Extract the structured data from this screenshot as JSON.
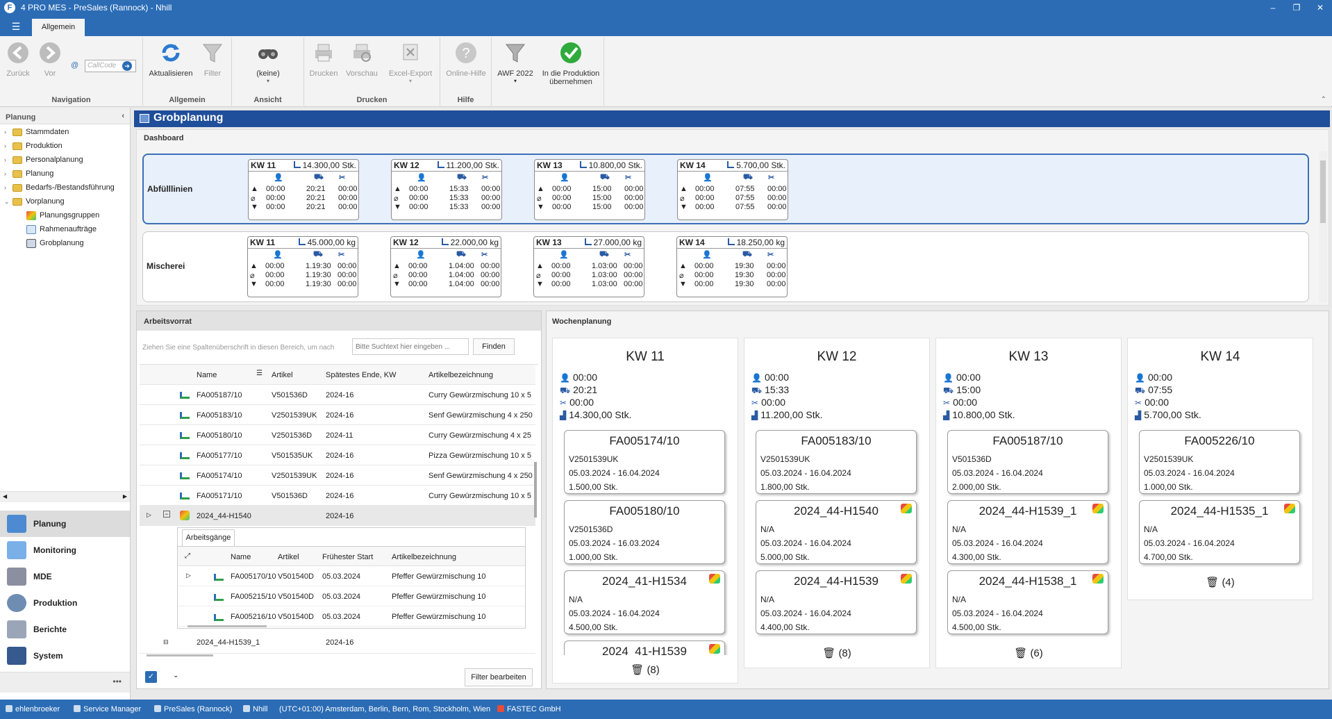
{
  "window": {
    "title": "4 PRO MES - PreSales (Rannock) - Nhill",
    "icon_letter": "F",
    "minimize": "–",
    "maximize": "❐",
    "close": "✕"
  },
  "ribbon": {
    "tab": "Allgemein",
    "navigation": {
      "label": "Navigation",
      "back": "Zurück",
      "forward": "Vor",
      "callcode_placeholder": "CallCode"
    },
    "allgemein": {
      "label": "Allgemein",
      "refresh": "Aktualisieren",
      "filter": "Filter"
    },
    "ansicht": {
      "label": "Ansicht",
      "view": "(keine)"
    },
    "drucken": {
      "label": "Drucken",
      "print": "Drucken",
      "preview": "Vorschau",
      "excel": "Excel-Export"
    },
    "hilfe": {
      "label": "Hilfe",
      "online": "Online-Hilfe"
    },
    "extra": {
      "awf": "AWF 2022",
      "prod_line1": "In die Produktion",
      "prod_line2": "übernehmen"
    }
  },
  "leftnav": {
    "title": "Planung",
    "tree": [
      "Stammdaten",
      "Produktion",
      "Personalplanung",
      "Planung",
      "Bedarfs-/Bestandsführung",
      "Vorplanung"
    ],
    "subtree": [
      "Planungsgruppen",
      "Rahmenaufträge",
      "Grobplanung"
    ],
    "modules": [
      "Planung",
      "Monitoring",
      "MDE",
      "Produktion",
      "Berichte",
      "System"
    ],
    "more": "•••"
  },
  "main": {
    "title": "Grobplanung"
  },
  "dashboard": {
    "title": "Dashboard",
    "rows": [
      {
        "label": "Abfülllinien",
        "weeks": [
          {
            "kw": "KW 11",
            "qty": "14.300,00 Stk.",
            "r": [
              [
                "00:00",
                "20:21",
                "00:00"
              ],
              [
                "00:00",
                "20:21",
                "00:00"
              ],
              [
                "00:00",
                "20:21",
                "00:00"
              ]
            ]
          },
          {
            "kw": "KW 12",
            "qty": "11.200,00 Stk.",
            "r": [
              [
                "00:00",
                "15:33",
                "00:00"
              ],
              [
                "00:00",
                "15:33",
                "00:00"
              ],
              [
                "00:00",
                "15:33",
                "00:00"
              ]
            ]
          },
          {
            "kw": "KW 13",
            "qty": "10.800,00 Stk.",
            "r": [
              [
                "00:00",
                "15:00",
                "00:00"
              ],
              [
                "00:00",
                "15:00",
                "00:00"
              ],
              [
                "00:00",
                "15:00",
                "00:00"
              ]
            ]
          },
          {
            "kw": "KW 14",
            "qty": "5.700,00 Stk.",
            "r": [
              [
                "00:00",
                "07:55",
                "00:00"
              ],
              [
                "00:00",
                "07:55",
                "00:00"
              ],
              [
                "00:00",
                "07:55",
                "00:00"
              ]
            ]
          }
        ]
      },
      {
        "label": "Mischerei",
        "weeks": [
          {
            "kw": "KW 11",
            "qty": "45.000,00 kg",
            "r": [
              [
                "00:00",
                "1.19:30",
                "00:00"
              ],
              [
                "00:00",
                "1.19:30",
                "00:00"
              ],
              [
                "00:00",
                "1.19:30",
                "00:00"
              ]
            ]
          },
          {
            "kw": "KW 12",
            "qty": "22.000,00 kg",
            "r": [
              [
                "00:00",
                "1.04:00",
                "00:00"
              ],
              [
                "00:00",
                "1.04:00",
                "00:00"
              ],
              [
                "00:00",
                "1.04:00",
                "00:00"
              ]
            ]
          },
          {
            "kw": "KW 13",
            "qty": "27.000,00 kg",
            "r": [
              [
                "00:00",
                "1.03:00",
                "00:00"
              ],
              [
                "00:00",
                "1.03:00",
                "00:00"
              ],
              [
                "00:00",
                "1.03:00",
                "00:00"
              ]
            ]
          },
          {
            "kw": "KW 14",
            "qty": "18.250,00 kg",
            "r": [
              [
                "00:00",
                "19:30",
                "00:00"
              ],
              [
                "00:00",
                "19:30",
                "00:00"
              ],
              [
                "00:00",
                "19:30",
                "00:00"
              ]
            ]
          }
        ]
      }
    ],
    "row_symbols": [
      "▲",
      "⌀",
      "▼"
    ]
  },
  "arbeitsvorrat": {
    "title": "Arbeitsvorrat",
    "group_hint": "Ziehen Sie eine Spaltenüberschrift in diesen Bereich, um nach",
    "search_placeholder": "Bitte Suchtext hier eingeben ...",
    "find": "Finden",
    "columns": [
      "Name",
      "Artikel",
      "Spätestes Ende, KW",
      "Artikelbezeichnung"
    ],
    "rows": [
      [
        "FA005187/10",
        "V501536D",
        "2024-16",
        "Curry Gewürzmischung 10 x 5"
      ],
      [
        "FA005183/10",
        "V2501539UK",
        "2024-16",
        "Senf Gewürzmischung 4 x 250"
      ],
      [
        "FA005180/10",
        "V2501536D",
        "2024-11",
        "Curry Gewürzmischung 4 x 25"
      ],
      [
        "FA005177/10",
        "V501535UK",
        "2024-16",
        "Pizza Gewürzmischung 10 x 5"
      ],
      [
        "FA005174/10",
        "V2501539UK",
        "2024-16",
        "Senf Gewürzmischung 4 x 250"
      ],
      [
        "FA005171/10",
        "V501536D",
        "2024-16",
        "Curry Gewürzmischung 10 x 5"
      ]
    ],
    "group_row": {
      "name": "2024_44-H1540",
      "kw": "2024-16"
    },
    "sub_tab": "Arbeitsgänge",
    "sub_columns": [
      "Name",
      "Artikel",
      "Frühester Start",
      "Artikelbezeichnung"
    ],
    "sub_rows": [
      [
        "FA005170/10",
        "V501540D",
        "05.03.2024",
        "Pfeffer Gewürzmischung 10"
      ],
      [
        "FA005215/10",
        "V501540D",
        "05.03.2024",
        "Pfeffer Gewürzmischung 10"
      ],
      [
        "FA005216/10",
        "V501540D",
        "05.03.2024",
        "Pfeffer Gewürzmischung 10"
      ]
    ],
    "partial_row": {
      "name": "2024_44-H1539_1",
      "kw": "2024-16"
    },
    "filter_edit": "Filter bearbeiten"
  },
  "wochenplanung": {
    "title": "Wochenplanung",
    "weeks": [
      {
        "kw": "KW 11",
        "s": [
          "00:00",
          "20:21",
          "00:00",
          "14.300,00 Stk."
        ],
        "trash": "(8)",
        "cards": [
          {
            "t": "FA005174/10",
            "a": "V2501539UK",
            "d": "05.03.2024 - 16.04.2024",
            "q": "1.500,00 Stk.",
            "g": false
          },
          {
            "t": "FA005180/10",
            "a": "V2501536D",
            "d": "05.03.2024 - 16.03.2024",
            "q": "1.000,00 Stk.",
            "g": false
          },
          {
            "t": "2024_41-H1534",
            "a": "N/A",
            "d": "05.03.2024 - 16.04.2024",
            "q": "4.500,00 Stk.",
            "g": true
          },
          {
            "t": "2024_41-H1539",
            "a": "",
            "d": "",
            "q": "",
            "g": true
          }
        ]
      },
      {
        "kw": "KW 12",
        "s": [
          "00:00",
          "15:33",
          "00:00",
          "11.200,00 Stk."
        ],
        "trash": "(8)",
        "cards": [
          {
            "t": "FA005183/10",
            "a": "V2501539UK",
            "d": "05.03.2024 - 16.04.2024",
            "q": "1.800,00 Stk.",
            "g": false
          },
          {
            "t": "2024_44-H1540",
            "a": "N/A",
            "d": "05.03.2024 - 16.04.2024",
            "q": "5.000,00 Stk.",
            "g": true
          },
          {
            "t": "2024_44-H1539",
            "a": "N/A",
            "d": "05.03.2024 - 16.04.2024",
            "q": "4.400,00 Stk.",
            "g": true
          }
        ]
      },
      {
        "kw": "KW 13",
        "s": [
          "00:00",
          "15:00",
          "00:00",
          "10.800,00 Stk."
        ],
        "trash": "(6)",
        "cards": [
          {
            "t": "FA005187/10",
            "a": "V501536D",
            "d": "05.03.2024 - 16.04.2024",
            "q": "2.000,00 Stk.",
            "g": false
          },
          {
            "t": "2024_44-H1539_1",
            "a": "N/A",
            "d": "05.03.2024 - 16.04.2024",
            "q": "4.300,00 Stk.",
            "g": true
          },
          {
            "t": "2024_44-H1538_1",
            "a": "N/A",
            "d": "05.03.2024 - 16.04.2024",
            "q": "4.500,00 Stk.",
            "g": true
          }
        ]
      },
      {
        "kw": "KW 14",
        "s": [
          "00:00",
          "07:55",
          "00:00",
          "5.700,00 Stk."
        ],
        "trash": "(4)",
        "cards": [
          {
            "t": "FA005226/10",
            "a": "V2501539UK",
            "d": "05.03.2024 - 16.04.2024",
            "q": "1.000,00 Stk.",
            "g": false
          },
          {
            "t": "2024_44-H1535_1",
            "a": "N/A",
            "d": "05.03.2024 - 16.04.2024",
            "q": "4.700,00 Stk.",
            "g": true
          }
        ]
      }
    ]
  },
  "statusbar": [
    "ehlenbroeker",
    "Service Manager",
    "PreSales (Rannock)",
    "Nhill",
    "(UTC+01:00) Amsterdam, Berlin, Bern, Rom, Stockholm, Wien",
    "FASTEC GmbH"
  ],
  "colors": {
    "accent": "#2b6cb5",
    "header": "#1f4e9a",
    "selected_row": "#3c6fb7"
  }
}
